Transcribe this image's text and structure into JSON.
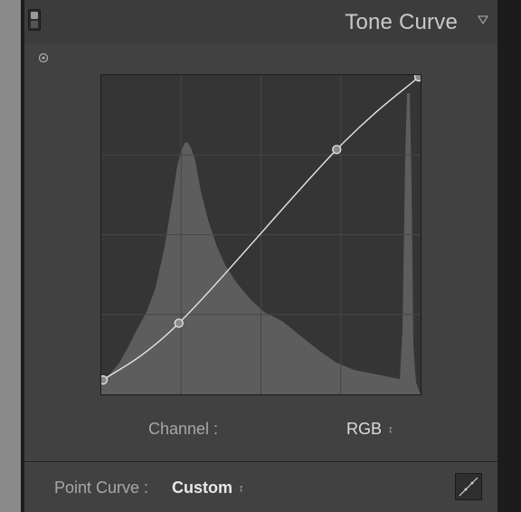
{
  "panel": {
    "title": "Tone Curve",
    "collapse_icon": "triangle-down-icon",
    "enable_switch_icon": "panel-switch-icon",
    "target_tool_icon": "target-adjustment-icon"
  },
  "channel": {
    "label": "Channel :",
    "value": "RGB",
    "arrows": "↕"
  },
  "point_curve": {
    "label": "Point Curve :",
    "value": "Custom",
    "arrows": "↕",
    "edit_icon": "edit-point-curve-icon"
  },
  "curve": {
    "control_points": [
      {
        "input": 0,
        "output": 4
      },
      {
        "input": 24,
        "output": 22
      },
      {
        "input": 74,
        "output": 77
      },
      {
        "input": 100,
        "output": 100
      }
    ]
  },
  "colors": {
    "curve": "#e6e6e6",
    "histogram": "#5d5d5d",
    "grid": "#474747",
    "panel": "#414141"
  }
}
